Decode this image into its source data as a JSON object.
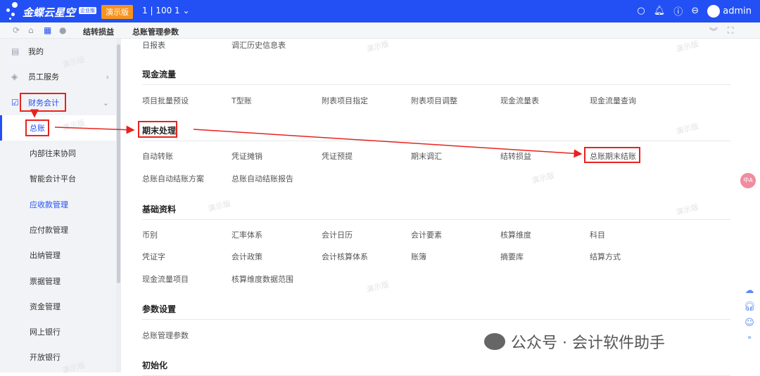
{
  "header": {
    "brand": "金蝶云星空",
    "edition_badge": "企业版",
    "demo_badge": "演示版",
    "org": "1 | 100 1",
    "user": "admin"
  },
  "tabs": [
    {
      "label": "结转损益"
    },
    {
      "label": "总账管理参数"
    }
  ],
  "sidebar": {
    "items": [
      {
        "label": "我的"
      },
      {
        "label": "员工服务"
      },
      {
        "label": "财务会计"
      },
      {
        "label": "总账"
      },
      {
        "label": "内部往来协同"
      },
      {
        "label": "智能会计平台"
      },
      {
        "label": "应收款管理"
      },
      {
        "label": "应付款管理"
      },
      {
        "label": "出纳管理"
      },
      {
        "label": "票据管理"
      },
      {
        "label": "资金管理"
      },
      {
        "label": "网上银行"
      },
      {
        "label": "开放银行"
      }
    ]
  },
  "main": {
    "top_items": [
      "日报表",
      "调汇历史信息表"
    ],
    "sections": [
      {
        "title": "现金流量",
        "rows": [
          [
            "项目批量预设",
            "T型账",
            "附表项目指定",
            "附表项目调整",
            "现金流量表",
            "现金流量查询"
          ]
        ]
      },
      {
        "title": "期末处理",
        "rows": [
          [
            "自动转账",
            "凭证摊销",
            "凭证预提",
            "期末调汇",
            "结转损益",
            "总账期末结账"
          ],
          [
            "总账自动结账方案",
            "总账自动结账报告"
          ]
        ]
      },
      {
        "title": "基础资料",
        "rows": [
          [
            "币别",
            "汇率体系",
            "会计日历",
            "会计要素",
            "核算维度",
            "科目"
          ],
          [
            "凭证字",
            "会计政策",
            "会计核算体系",
            "账簿",
            "摘要库",
            "结算方式"
          ],
          [
            "现金流量项目",
            "核算维度数据范围"
          ]
        ]
      },
      {
        "title": "参数设置",
        "rows": [
          [
            "总账管理参数"
          ]
        ]
      },
      {
        "title": "初始化",
        "rows": []
      }
    ]
  },
  "watermark": "演示版",
  "lang_button": "中A",
  "overlay_watermark": "公众号 · 会计软件助手",
  "colors": {
    "header": "#2250f4",
    "demo": "#f7931e",
    "annotation": "#e8231e",
    "active": "#2250f4"
  }
}
